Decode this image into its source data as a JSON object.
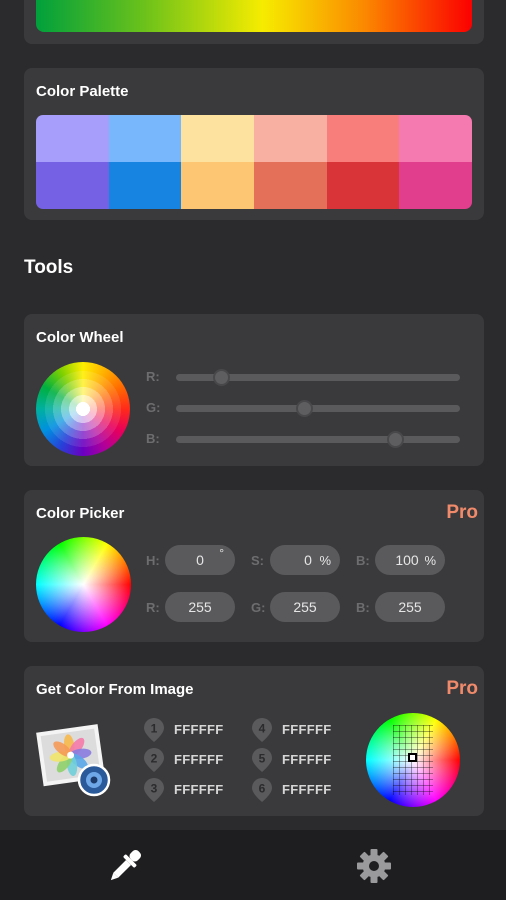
{
  "palette": {
    "title": "Color Palette",
    "colors": [
      "#a79dfb",
      "#78b7fb",
      "#fde19f",
      "#f7b0a1",
      "#f87e7b",
      "#f47ab0",
      "#7561e3",
      "#1784e2",
      "#fdc672",
      "#e47059",
      "#d93539",
      "#e13f8e"
    ]
  },
  "tools_heading": "Tools",
  "color_wheel": {
    "title": "Color Wheel",
    "sliders": [
      {
        "label": "R:",
        "value": 0.16
      },
      {
        "label": "G:",
        "value": 0.45
      },
      {
        "label": "B:",
        "value": 0.77
      }
    ]
  },
  "color_picker": {
    "title": "Color Picker",
    "badge": "Pro",
    "h_label": "H:",
    "h_value": "0",
    "h_unit": "°",
    "s_label": "S:",
    "s_value": "0",
    "s_unit": "%",
    "b_label": "B:",
    "b_value": "100",
    "b_unit": "%",
    "r_label": "R:",
    "r_value": "255",
    "g_label": "G:",
    "g_value": "255",
    "b2_label": "B:",
    "b2_value": "255"
  },
  "image_picker": {
    "title": "Get Color From Image",
    "badge": "Pro",
    "swatches": [
      {
        "num": "1",
        "hex": "FFFFFF"
      },
      {
        "num": "2",
        "hex": "FFFFFF"
      },
      {
        "num": "3",
        "hex": "FFFFFF"
      },
      {
        "num": "4",
        "hex": "FFFFFF"
      },
      {
        "num": "5",
        "hex": "FFFFFF"
      },
      {
        "num": "6",
        "hex": "FFFFFF"
      }
    ]
  },
  "nav": {
    "items": [
      {
        "icon": "eyedropper-icon",
        "active": true
      },
      {
        "icon": "gear-icon",
        "active": false
      }
    ]
  },
  "colors": {
    "accent_pro": "#f08a6a",
    "background": "#2b2b2d",
    "card": "#3a3a3c"
  }
}
